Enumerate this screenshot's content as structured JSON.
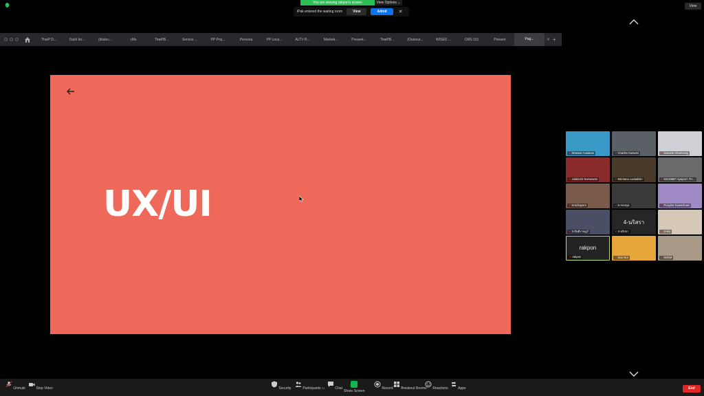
{
  "banner": {
    "viewing_text": "You are viewing rakpon's screen",
    "view_options": "View Options ⌄",
    "view_btn": "View"
  },
  "waiting_room": {
    "message": "iPak entered the waiting room",
    "view": "View",
    "admit": "Admit",
    "close": "✕"
  },
  "browser": {
    "tabs": [
      "ThaiP D...",
      "Dash bo...",
      "(blistec...",
      "cMs",
      "ThaiPB...",
      "Service ...",
      "PP Proj...",
      "Persona",
      "PP Loca...",
      "ALTV R...",
      "Marketi...",
      "Present...",
      "ThaiPB...",
      "(Outsour...",
      "WISED ...",
      "CMS 101",
      "Present",
      "Pag..."
    ],
    "active_tab_index": 17
  },
  "slide": {
    "title": "UX/UI",
    "bg": "#ee6959"
  },
  "participants": [
    {
      "name": "Nirawan Ausakan",
      "bg": "#3a9ac7"
    },
    {
      "name": "Charles Kaewsri",
      "bg": "#5b5f66"
    },
    {
      "name": "Danarai Khamsang",
      "bg": "#cfcfd6"
    },
    {
      "name": "Julabock Noesuwan",
      "bg": "#8a2a2a"
    },
    {
      "name": "Montana Lasladisin",
      "bg": "#4a3a2a"
    },
    {
      "name": "63119687 Apaporn TH...",
      "bg": "#6a6a6a"
    },
    {
      "name": "Kotchaporn",
      "bg": "#7a5a4a"
    },
    {
      "name": "6-Areeya",
      "bg": "#3a3a3a"
    },
    {
      "name": "Punyisa Kaewchuen",
      "bg": "#a08ac6"
    },
    {
      "name": "3-สันติราษฎร์",
      "bg": "#4a4f66"
    },
    {
      "name": "4-นริสรา",
      "bg": "#262626",
      "center": "4-นริสรา"
    },
    {
      "name": "4-ชช",
      "bg": "#d5c8b6"
    },
    {
      "name": "rakpon",
      "bg": "#232323",
      "center": "rakpon",
      "highlight": true
    },
    {
      "name": "Noo Nut",
      "bg": "#e6a63c"
    },
    {
      "name": "KEEM",
      "bg": "#a89a86"
    }
  ],
  "toolbar": {
    "unmute": "Unmute",
    "stop_video": "Stop Video",
    "security": "Security",
    "participants": "Participants",
    "participants_count": "21",
    "chat": "Chat",
    "share_screen": "Share Screen",
    "record": "Record",
    "breakout": "Breakout Rooms",
    "reactions": "Reactions",
    "apps": "Apps",
    "end": "End"
  }
}
